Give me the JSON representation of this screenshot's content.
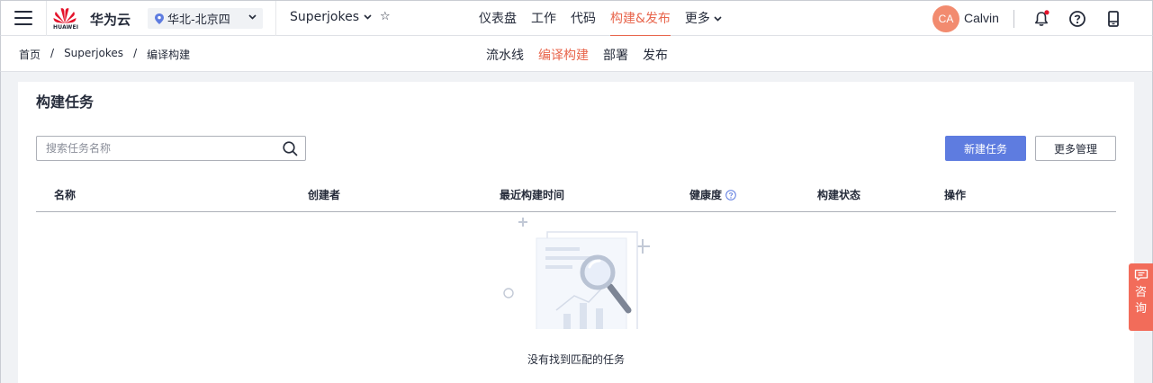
{
  "header": {
    "brand_logo_text": "HUAWEI",
    "brand": "华为云",
    "region": "华北-北京四",
    "project": "Superjokes",
    "nav": [
      "仪表盘",
      "工作",
      "代码",
      "构建&发布",
      "更多"
    ],
    "active_nav": "构建&发布",
    "user_initials": "CA",
    "user_name": "Calvin",
    "accent_color": "#e8664d"
  },
  "subheader": {
    "breadcrumbs": [
      "首页",
      "Superjokes",
      "编译构建"
    ],
    "breadcrumb_separator": "/",
    "tabs": [
      "流水线",
      "编译构建",
      "部署",
      "发布"
    ],
    "active_tab": "编译构建"
  },
  "main": {
    "title": "构建任务",
    "search_placeholder": "搜索任务名称",
    "search_value": "",
    "new_button": "新建任务",
    "more_button": "更多管理",
    "columns": [
      "名称",
      "创建者",
      "最近构建时间",
      "健康度",
      "构建状态",
      "操作"
    ],
    "rows": [],
    "empty_text": "没有找到匹配的任务",
    "primary_color": "#5e7ce0"
  },
  "consult": {
    "label_1": "咨",
    "label_2": "询",
    "color": "#f26c5a"
  }
}
